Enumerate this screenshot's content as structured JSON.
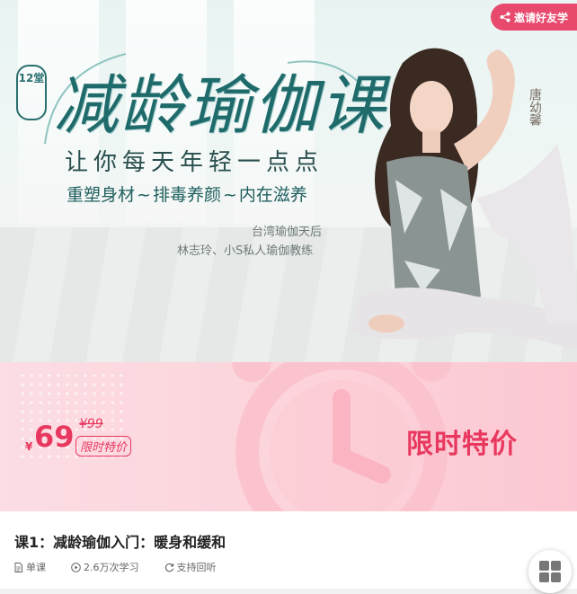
{
  "banner": {
    "share_label": "邀请好友学",
    "badge": "12堂",
    "title": "减龄瑜伽课",
    "subtitle": "让你每天年轻一点点",
    "tagline": [
      "重塑身材",
      "排毒养颜",
      "内在滋养"
    ],
    "tagline_separator": "~",
    "credit_line1": "台湾瑜伽天后",
    "credit_line2": "林志玲、小S私人瑜伽教练",
    "instructor": "唐幼馨"
  },
  "price": {
    "currency": "¥",
    "current": "69",
    "original": "¥99",
    "tag": "限时特价",
    "promo": "限时特价"
  },
  "lesson": {
    "title": "课1：减龄瑜伽入门：暖身和缓和",
    "type": "单课",
    "views": "2.6万次学习",
    "replay": "支持回听"
  },
  "icons": {
    "share": "share-icon",
    "doc": "document-icon",
    "play": "play-circle-icon",
    "replay": "replay-icon",
    "grid": "grid-icon"
  },
  "colors": {
    "accent": "#e8385f",
    "share_bg": "#e84a6e",
    "title_teal": "#1f6a6a"
  }
}
